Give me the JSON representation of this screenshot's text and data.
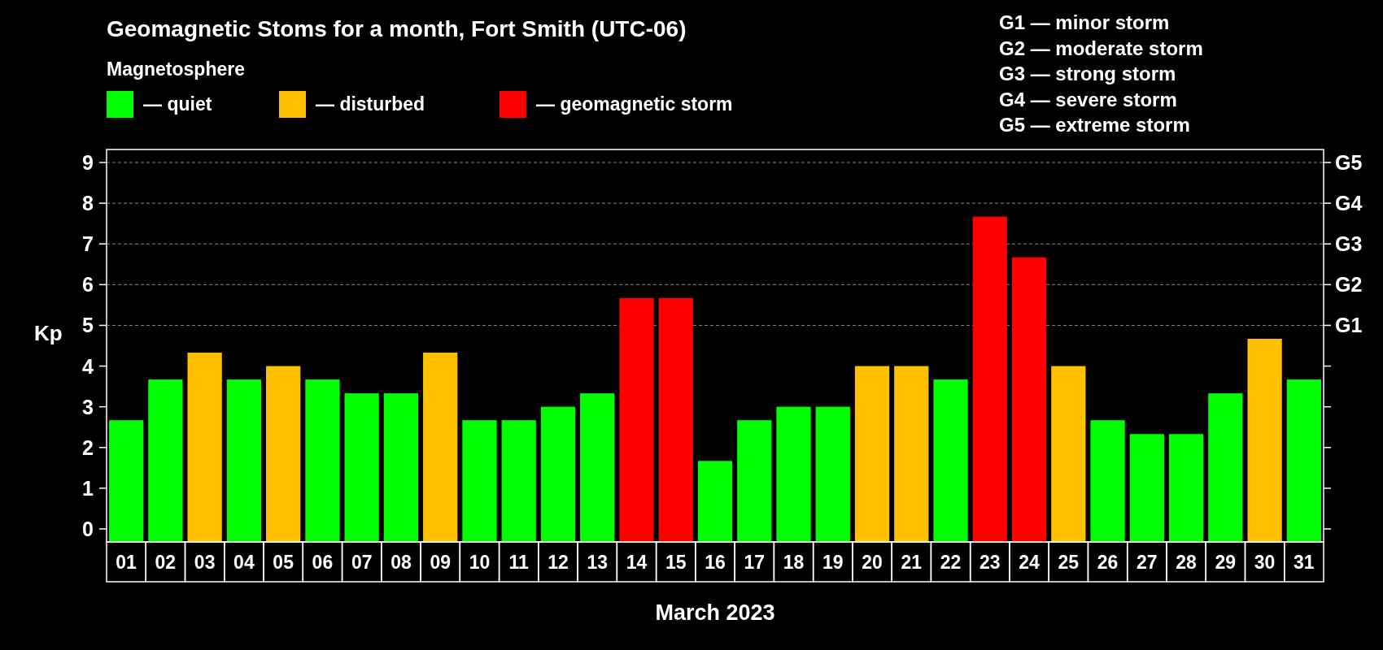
{
  "header": {
    "title": "Geomagnetic Stoms for a month, Fort Smith (UTC-06)",
    "subtitle": "Magnetosphere"
  },
  "legend": {
    "items": [
      {
        "label": "— quiet",
        "color": "#00ff00"
      },
      {
        "label": "— disturbed",
        "color": "#ffc000"
      },
      {
        "label": "— geomagnetic storm",
        "color": "#ff0000"
      }
    ]
  },
  "storm_scale": [
    "G1 — minor storm",
    "G2 — moderate storm",
    "G3 — strong storm",
    "G4 — severe storm",
    "G5 — extreme storm"
  ],
  "chart": {
    "right_axis_labels": [
      "G5",
      "G4",
      "G3",
      "G2",
      "G1"
    ],
    "chart_data": {
      "type": "bar",
      "xlabel": "March 2023",
      "ylabel": "Kp",
      "categories": [
        "01",
        "02",
        "03",
        "04",
        "05",
        "06",
        "07",
        "08",
        "09",
        "10",
        "11",
        "12",
        "13",
        "14",
        "15",
        "16",
        "17",
        "18",
        "19",
        "20",
        "21",
        "22",
        "23",
        "24",
        "25",
        "26",
        "27",
        "28",
        "29",
        "30",
        "31"
      ],
      "values": [
        2.67,
        3.67,
        4.33,
        3.67,
        4.0,
        3.67,
        3.33,
        3.33,
        4.33,
        2.67,
        2.67,
        3.0,
        3.33,
        5.67,
        5.67,
        1.67,
        2.67,
        3.0,
        3.0,
        4.0,
        4.0,
        3.67,
        7.67,
        6.67,
        4.0,
        2.67,
        2.33,
        2.33,
        3.33,
        4.67,
        3.67
      ],
      "grid": true,
      "ylim": [
        0,
        9
      ],
      "yticks": [
        0,
        1,
        2,
        3,
        4,
        5,
        6,
        7,
        8,
        9
      ]
    }
  }
}
